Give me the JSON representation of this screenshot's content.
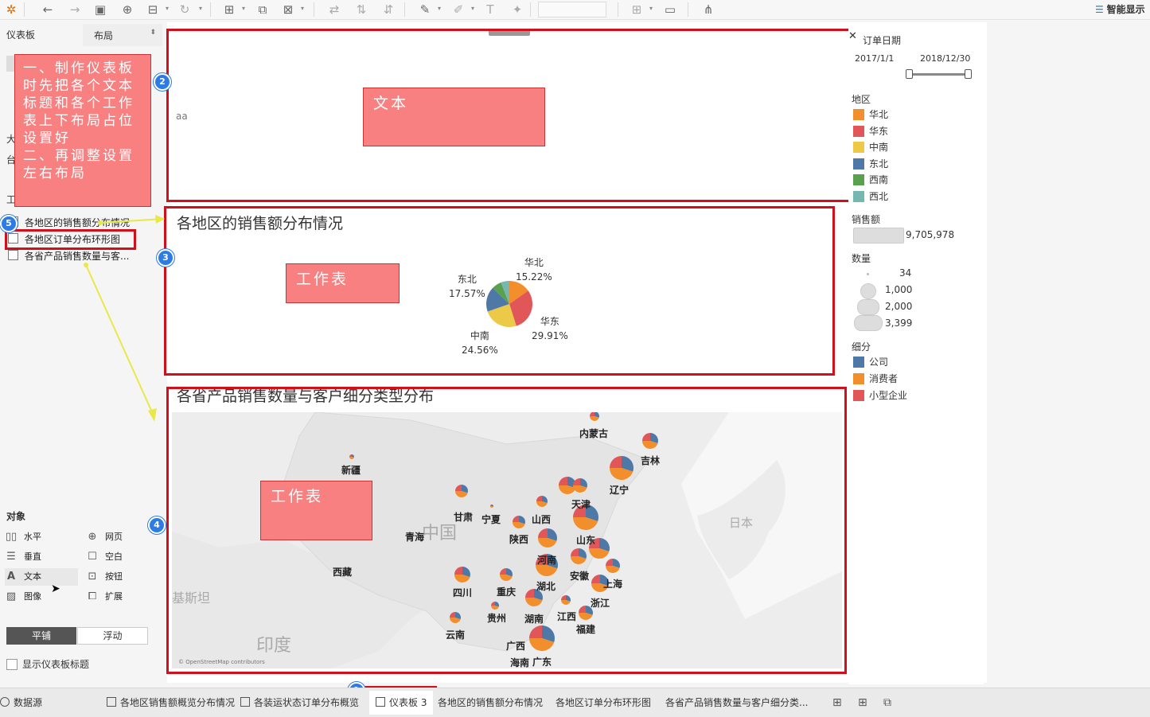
{
  "toolbar": {
    "smart_show_label": "智能显示",
    "icons": [
      "tableau-logo-icon",
      "undo-icon",
      "redo-icon",
      "save-icon",
      "new-datasource-icon",
      "datasource-icon",
      "refresh-icon",
      "new-sheet-icon",
      "duplicate-sheet-icon",
      "clear-sheet-icon",
      "swap-icon",
      "sort-asc-icon",
      "sort-desc-icon",
      "highlight-icon",
      "annotation-icon",
      "fit-icon",
      "fix-axes-icon",
      "pin-icon",
      "labels-icon",
      "presentation-icon",
      "share-icon"
    ]
  },
  "left_panel": {
    "tabs": {
      "dashboard": "仪表板",
      "layout": "布局"
    },
    "partial_labels": {
      "size": "大",
      "device": "台",
      "sheets_head": "工"
    },
    "sheets": [
      "各地区的销售额分布情况",
      "各地区订单分布环形图",
      "各省产品销售数量与客..."
    ],
    "objects_title": "对象",
    "objects": [
      {
        "label": "水平",
        "icon": "horizontal-icon"
      },
      {
        "label": "网页",
        "icon": "web-icon"
      },
      {
        "label": "垂直",
        "icon": "vertical-icon"
      },
      {
        "label": "空白",
        "icon": "blank-icon"
      },
      {
        "label": "文本",
        "icon": "text-icon"
      },
      {
        "label": "按钮",
        "icon": "button-icon"
      },
      {
        "label": "图像",
        "icon": "image-icon"
      },
      {
        "label": "扩展",
        "icon": "extension-icon"
      }
    ],
    "tile_label": "平铺",
    "float_label": "浮动",
    "show_title_label": "显示仪表板标题"
  },
  "annotation": {
    "note": "一、制作仪表板时先把各个文本标题和各个工作表上下布局占位设置好\n二、再调整设置左右布局",
    "steps": [
      "1",
      "2",
      "3",
      "4",
      "5"
    ],
    "box_text": "文本",
    "box_sheet1": "工作表",
    "box_sheet2": "工作表"
  },
  "canvas": {
    "text_placeholder": "aa",
    "sheet1_title": "各地区的销售额分布情况",
    "sheet2_title": "各省产品销售数量与客户细分类型分布",
    "map_attribution": "© OpenStreetMap contributors",
    "geo_labels": {
      "china": "中国",
      "japan": "日本",
      "india": "印度",
      "pakistan": "基斯坦"
    }
  },
  "chart_data": {
    "type": "pie",
    "title": "各地区的销售额分布情况",
    "slices": [
      {
        "name": "华北",
        "value": 15.22,
        "label": "15.22%",
        "color": "#f28e2b"
      },
      {
        "name": "华东",
        "value": 29.91,
        "label": "29.91%",
        "color": "#e15759"
      },
      {
        "name": "中南",
        "value": 24.56,
        "label": "24.56%",
        "color": "#edc948"
      },
      {
        "name": "东北",
        "value": 17.57,
        "label": "17.57%",
        "color": "#4e79a7"
      },
      {
        "name": "西南",
        "value": 6.9,
        "color": "#59a14f"
      },
      {
        "name": "西北",
        "value": 5.84,
        "color": "#76b7b2"
      }
    ]
  },
  "map_provinces": [
    {
      "name": "内蒙古"
    },
    {
      "name": "吉林"
    },
    {
      "name": "辽宁"
    },
    {
      "name": "新疆"
    },
    {
      "name": "天津"
    },
    {
      "name": "甘肃"
    },
    {
      "name": "宁夏"
    },
    {
      "name": "山西"
    },
    {
      "name": "青海"
    },
    {
      "name": "陕西"
    },
    {
      "name": "山东"
    },
    {
      "name": "河南"
    },
    {
      "name": "西藏"
    },
    {
      "name": "安徽"
    },
    {
      "name": "上海"
    },
    {
      "name": "四川"
    },
    {
      "name": "重庆"
    },
    {
      "name": "湖北"
    },
    {
      "name": "浙江"
    },
    {
      "name": "贵州"
    },
    {
      "name": "湖南"
    },
    {
      "name": "江西"
    },
    {
      "name": "云南"
    },
    {
      "name": "福建"
    },
    {
      "name": "广西"
    },
    {
      "name": "海南"
    },
    {
      "name": "广东"
    }
  ],
  "legend": {
    "date_title": "订单日期",
    "date_start": "2017/1/1",
    "date_end": "2018/12/30",
    "region_title": "地区",
    "regions": [
      {
        "name": "华北",
        "color": "#f28e2b"
      },
      {
        "name": "华东",
        "color": "#e15759"
      },
      {
        "name": "中南",
        "color": "#edc948"
      },
      {
        "name": "东北",
        "color": "#4e79a7"
      },
      {
        "name": "西南",
        "color": "#59a14f"
      },
      {
        "name": "西北",
        "color": "#76b7b2"
      }
    ],
    "sales_title": "销售额",
    "sales_value": "9,705,978",
    "qty_title": "数量",
    "qty_values": [
      "34",
      "1,000",
      "2,000",
      "3,399"
    ],
    "segment_title": "细分",
    "segments": [
      {
        "name": "公司",
        "color": "#4e79a7"
      },
      {
        "name": "消费者",
        "color": "#f28e2b"
      },
      {
        "name": "小型企业",
        "color": "#e15759"
      }
    ]
  },
  "tabs": {
    "datasource": "数据源",
    "sheets": [
      "各地区销售额概览分布情况",
      "各装运状态订单分布概览",
      "仪表板 3",
      "各地区的销售额分布情况",
      "各地区订单分布环形图",
      "各省产品销售数量与客户细分类..."
    ]
  }
}
